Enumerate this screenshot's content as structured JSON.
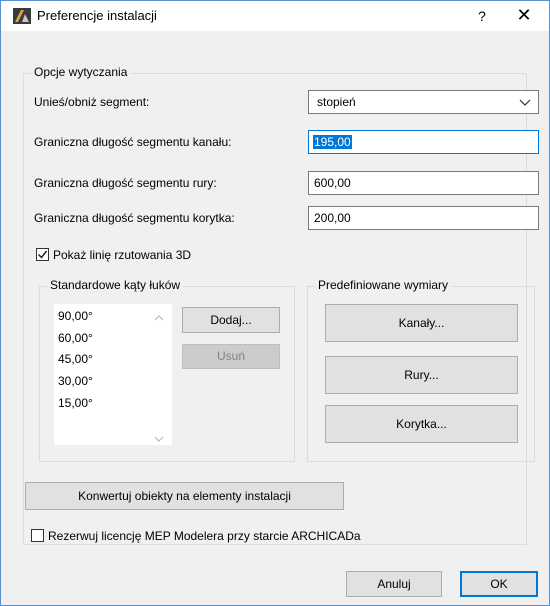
{
  "window": {
    "title": "Preferencje instalacji",
    "help_label": "?",
    "close_label": "✕"
  },
  "layout_group": {
    "label": "Opcje wytyczania",
    "raise_label": "Unieś/obniż segment:",
    "raise_value": "stopień",
    "duct_label": "Graniczna długość segmentu kanału:",
    "duct_value": "195,00",
    "pipe_label": "Graniczna długość segmentu rury:",
    "pipe_value": "600,00",
    "tray_label": "Graniczna długość segmentu korytka:",
    "tray_value": "200,00",
    "show_3d_label": "Pokaż linię rzutowania 3D",
    "show_3d_checked": true
  },
  "angles_group": {
    "label": "Standardowe kąty łuków",
    "items": [
      "90,00°",
      "60,00°",
      "45,00°",
      "30,00°",
      "15,00°"
    ],
    "add_label": "Dodaj...",
    "remove_label": "Usuń"
  },
  "sizes_group": {
    "label": "Predefiniowane wymiary",
    "ducts_label": "Kanały...",
    "pipes_label": "Rury...",
    "trays_label": "Korytka..."
  },
  "convert_label": "Konwertuj obiekty na elementy instalacji",
  "reserve_label": "Rezerwuj licencję MEP Modelera przy starcie ARCHICADa",
  "reserve_checked": false,
  "footer": {
    "cancel_label": "Anuluj",
    "ok_label": "OK"
  }
}
